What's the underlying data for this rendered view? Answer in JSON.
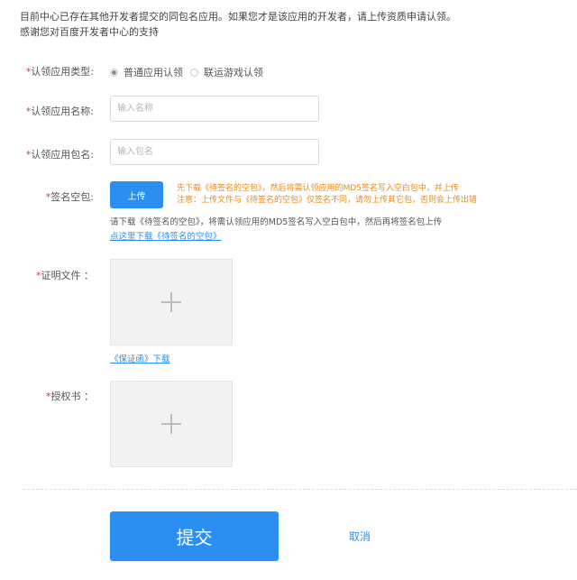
{
  "notice": {
    "line1": "目前中心已存在其他开发者提交的同包名应用。如果您才是该应用的开发者，请上传资质申请认领。",
    "line2": "感谢您对百度开发者中心的支持"
  },
  "form": {
    "required_mark": "*",
    "type": {
      "label": "认领应用类型:",
      "options": [
        {
          "label": "普通应用认领",
          "selected": true
        },
        {
          "label": "联运游戏认领",
          "selected": false
        }
      ]
    },
    "app_name": {
      "label": "认领应用名称:",
      "placeholder": "输入名称",
      "value": ""
    },
    "package_name": {
      "label": "认领应用包名:",
      "placeholder": "输入包名",
      "value": ""
    },
    "signature": {
      "label": "签名空包:",
      "upload_label": "上传",
      "warning_line1": "先下载《待签名的空包》，然后将需认领应用的MD5签名写入空白包中，并上传",
      "warning_line2": "注意：上传文件与《待签名的空包》仅签名不同，请勿上传其它包，否则会上传出错",
      "info": "请下载《待签名的空包》，将需认领应用的MD5签名写入空白包中，然后再将签名包上传",
      "download_link": "点这里下载《待签名的空包》"
    },
    "proof": {
      "label": "证明文件 ：",
      "link": "《保证函》下载"
    },
    "authorization": {
      "label": "授权书 ："
    }
  },
  "actions": {
    "submit": "提交",
    "cancel": "取消"
  },
  "colors": {
    "accent": "#2a8ff0",
    "warning": "#ee8a0f",
    "required": "#e4393c"
  }
}
